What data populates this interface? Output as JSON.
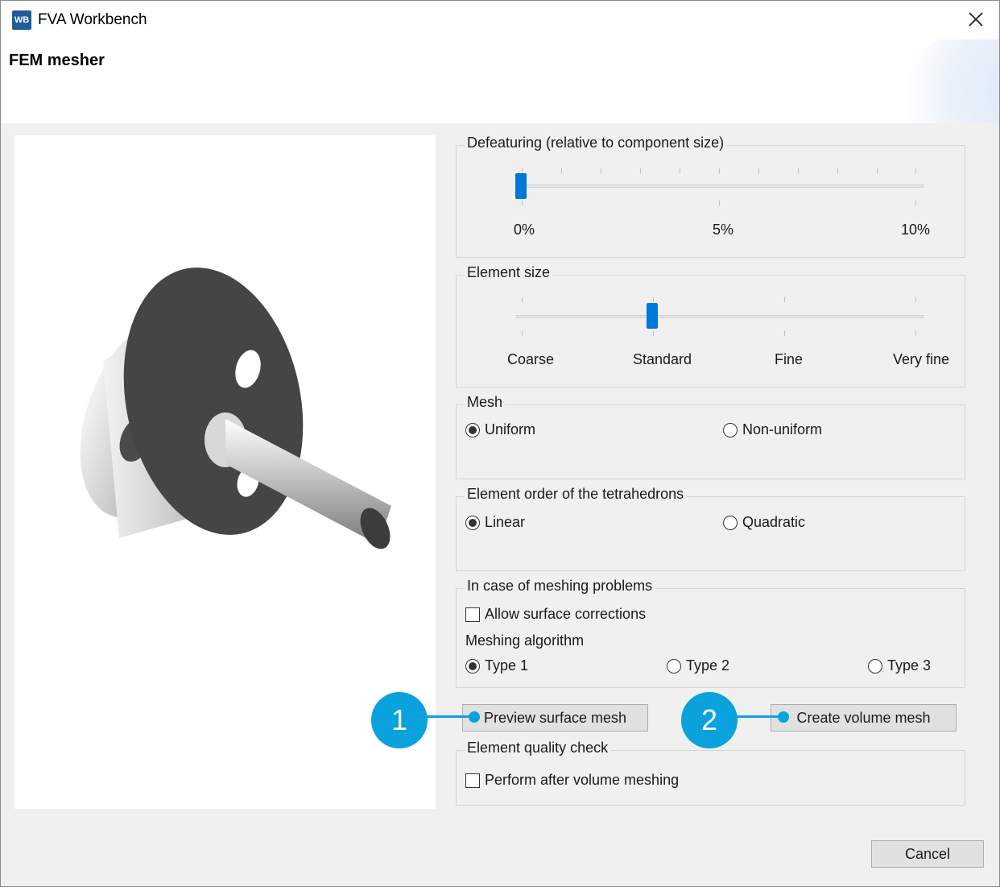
{
  "window": {
    "app_icon_text": "WB",
    "title": "FVA Workbench",
    "header_title": "FEM mesher"
  },
  "defeaturing": {
    "legend": "Defeaturing (relative to component size)",
    "labels": [
      "0%",
      "5%",
      "10%"
    ],
    "value_fraction": 0.0
  },
  "element_size": {
    "legend": "Element size",
    "labels": [
      "Coarse",
      "Standard",
      "Fine",
      "Very fine"
    ],
    "selected": "Standard"
  },
  "mesh": {
    "legend": "Mesh",
    "options": [
      "Uniform",
      "Non-uniform"
    ],
    "selected": "Uniform"
  },
  "element_order": {
    "legend": "Element order of the tetrahedrons",
    "options": [
      "Linear",
      "Quadratic"
    ],
    "selected": "Linear"
  },
  "meshing_problems": {
    "legend": "In case of meshing problems",
    "allow_surface_corrections": "Allow surface corrections",
    "algorithm_label": "Meshing algorithm",
    "algorithms": [
      "Type 1",
      "Type 2",
      "Type 3"
    ],
    "selected": "Type 1"
  },
  "buttons": {
    "preview_surface_mesh": "Preview surface mesh",
    "create_volume_mesh": "Create volume mesh",
    "cancel": "Cancel"
  },
  "quality_check": {
    "legend": "Element quality check",
    "perform_after": "Perform after volume meshing"
  },
  "callouts": [
    "1",
    "2"
  ],
  "colors": {
    "accent": "#0078d7",
    "callout": "#0aa2dc"
  }
}
